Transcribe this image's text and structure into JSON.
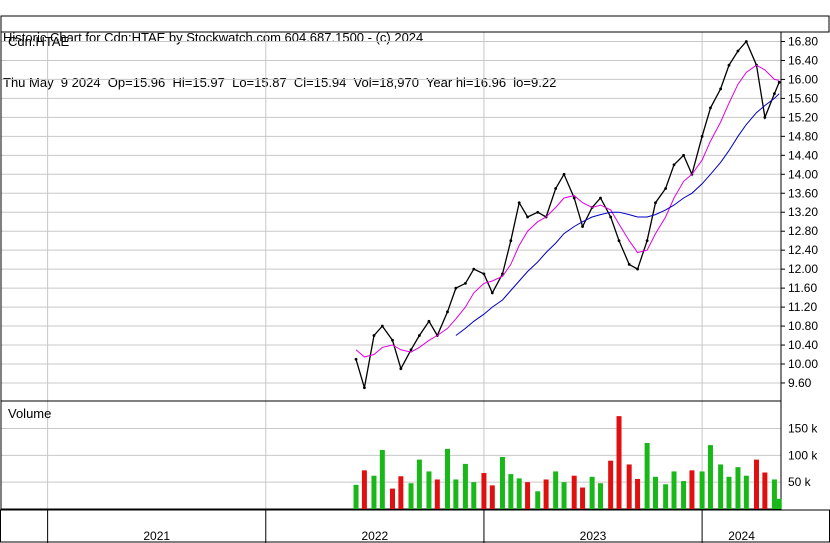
{
  "header": {
    "line1": "Historic Chart for Cdn:HTAE by Stockwatch.com 604.687.1500 - (c) 2024",
    "line2": "Thu May  9 2024  Op=15.96  Hi=15.97  Lo=15.87  Cl=15.94  Vol=18,970  Year hi=16.96  lo=9.22"
  },
  "chart_data": {
    "type": "line",
    "symbol_label": "Cdn:HTAE",
    "volume_label": "Volume",
    "x_axis_years": [
      "2021",
      "2022",
      "2023",
      "2024"
    ],
    "price_axis": {
      "ticks": [
        "16.80",
        "16.40",
        "16.00",
        "15.60",
        "15.20",
        "14.80",
        "14.40",
        "14.00",
        "13.60",
        "13.20",
        "12.80",
        "12.40",
        "12.00",
        "11.60",
        "11.20",
        "10.80",
        "10.40",
        "10.00",
        "9.60"
      ],
      "ylim": [
        9.22,
        17.0
      ]
    },
    "volume_axis": {
      "ticks": [
        "150 k",
        "100 k",
        "50 k"
      ],
      "ylim": [
        0,
        190000
      ]
    },
    "price_series": {
      "name": "Cdn:HTAE",
      "dates": [
        "2022-06-01",
        "2022-06-15",
        "2022-07-01",
        "2022-07-15",
        "2022-08-01",
        "2022-08-15",
        "2022-09-01",
        "2022-09-15",
        "2022-10-01",
        "2022-10-15",
        "2022-11-01",
        "2022-11-15",
        "2022-12-01",
        "2022-12-15",
        "2023-01-01",
        "2023-01-15",
        "2023-02-01",
        "2023-02-15",
        "2023-03-01",
        "2023-03-15",
        "2023-04-01",
        "2023-04-15",
        "2023-05-01",
        "2023-05-15",
        "2023-06-01",
        "2023-06-15",
        "2023-07-01",
        "2023-07-15",
        "2023-08-01",
        "2023-08-15",
        "2023-09-01",
        "2023-09-15",
        "2023-10-01",
        "2023-10-15",
        "2023-11-01",
        "2023-11-15",
        "2023-12-01",
        "2023-12-15",
        "2024-01-01",
        "2024-01-15",
        "2024-02-01",
        "2024-02-15",
        "2024-03-01",
        "2024-03-15",
        "2024-04-01",
        "2024-04-15",
        "2024-05-01",
        "2024-05-09"
      ],
      "values": [
        10.1,
        9.5,
        10.6,
        10.8,
        10.5,
        9.9,
        10.3,
        10.6,
        10.9,
        10.6,
        11.1,
        11.6,
        11.7,
        12.0,
        11.9,
        11.5,
        11.9,
        12.6,
        13.4,
        13.1,
        13.2,
        13.1,
        13.7,
        14.0,
        13.5,
        12.9,
        13.3,
        13.5,
        13.1,
        12.6,
        12.1,
        12.0,
        12.6,
        13.4,
        13.7,
        14.2,
        14.4,
        14.0,
        14.8,
        15.4,
        15.8,
        16.3,
        16.6,
        16.8,
        16.3,
        15.2,
        15.7,
        15.94
      ]
    },
    "ma_short": {
      "values": [
        10.3,
        10.15,
        10.2,
        10.35,
        10.4,
        10.3,
        10.25,
        10.35,
        10.5,
        10.6,
        10.75,
        10.95,
        11.2,
        11.5,
        11.7,
        11.75,
        11.85,
        12.1,
        12.5,
        12.8,
        13.0,
        13.1,
        13.3,
        13.5,
        13.55,
        13.4,
        13.3,
        13.35,
        13.25,
        12.95,
        12.6,
        12.35,
        12.4,
        12.75,
        13.1,
        13.5,
        13.85,
        14.0,
        14.3,
        14.7,
        15.1,
        15.5,
        15.9,
        16.15,
        16.3,
        16.2,
        16.0,
        15.98
      ]
    },
    "ma_long": {
      "values": [
        null,
        null,
        null,
        null,
        null,
        null,
        null,
        null,
        null,
        null,
        null,
        10.6,
        10.75,
        10.9,
        11.05,
        11.2,
        11.35,
        11.55,
        11.75,
        11.95,
        12.15,
        12.35,
        12.55,
        12.75,
        12.9,
        13.0,
        13.1,
        13.15,
        13.2,
        13.2,
        13.15,
        13.1,
        13.1,
        13.15,
        13.25,
        13.35,
        13.5,
        13.6,
        13.8,
        14.0,
        14.25,
        14.5,
        14.8,
        15.05,
        15.3,
        15.45,
        15.6,
        15.7
      ]
    },
    "volume": {
      "values": [
        45000,
        72000,
        62000,
        110000,
        38000,
        61000,
        48000,
        92000,
        70000,
        55000,
        112000,
        55000,
        84000,
        50000,
        67000,
        44000,
        97000,
        65000,
        57000,
        50000,
        33000,
        55000,
        70000,
        50000,
        62000,
        40000,
        60000,
        48000,
        90000,
        173000,
        83000,
        56000,
        123000,
        60000,
        46000,
        70000,
        52000,
        72000,
        70000,
        119000,
        83000,
        60000,
        78000,
        62000,
        92000,
        68000,
        55000,
        18970
      ],
      "up_color": "#18b818",
      "down_color": "#e01010"
    },
    "colors": {
      "price": "#000000",
      "ma_short": "#e000e0",
      "ma_long": "#0000c0",
      "grid": "#c8c8c8"
    }
  }
}
